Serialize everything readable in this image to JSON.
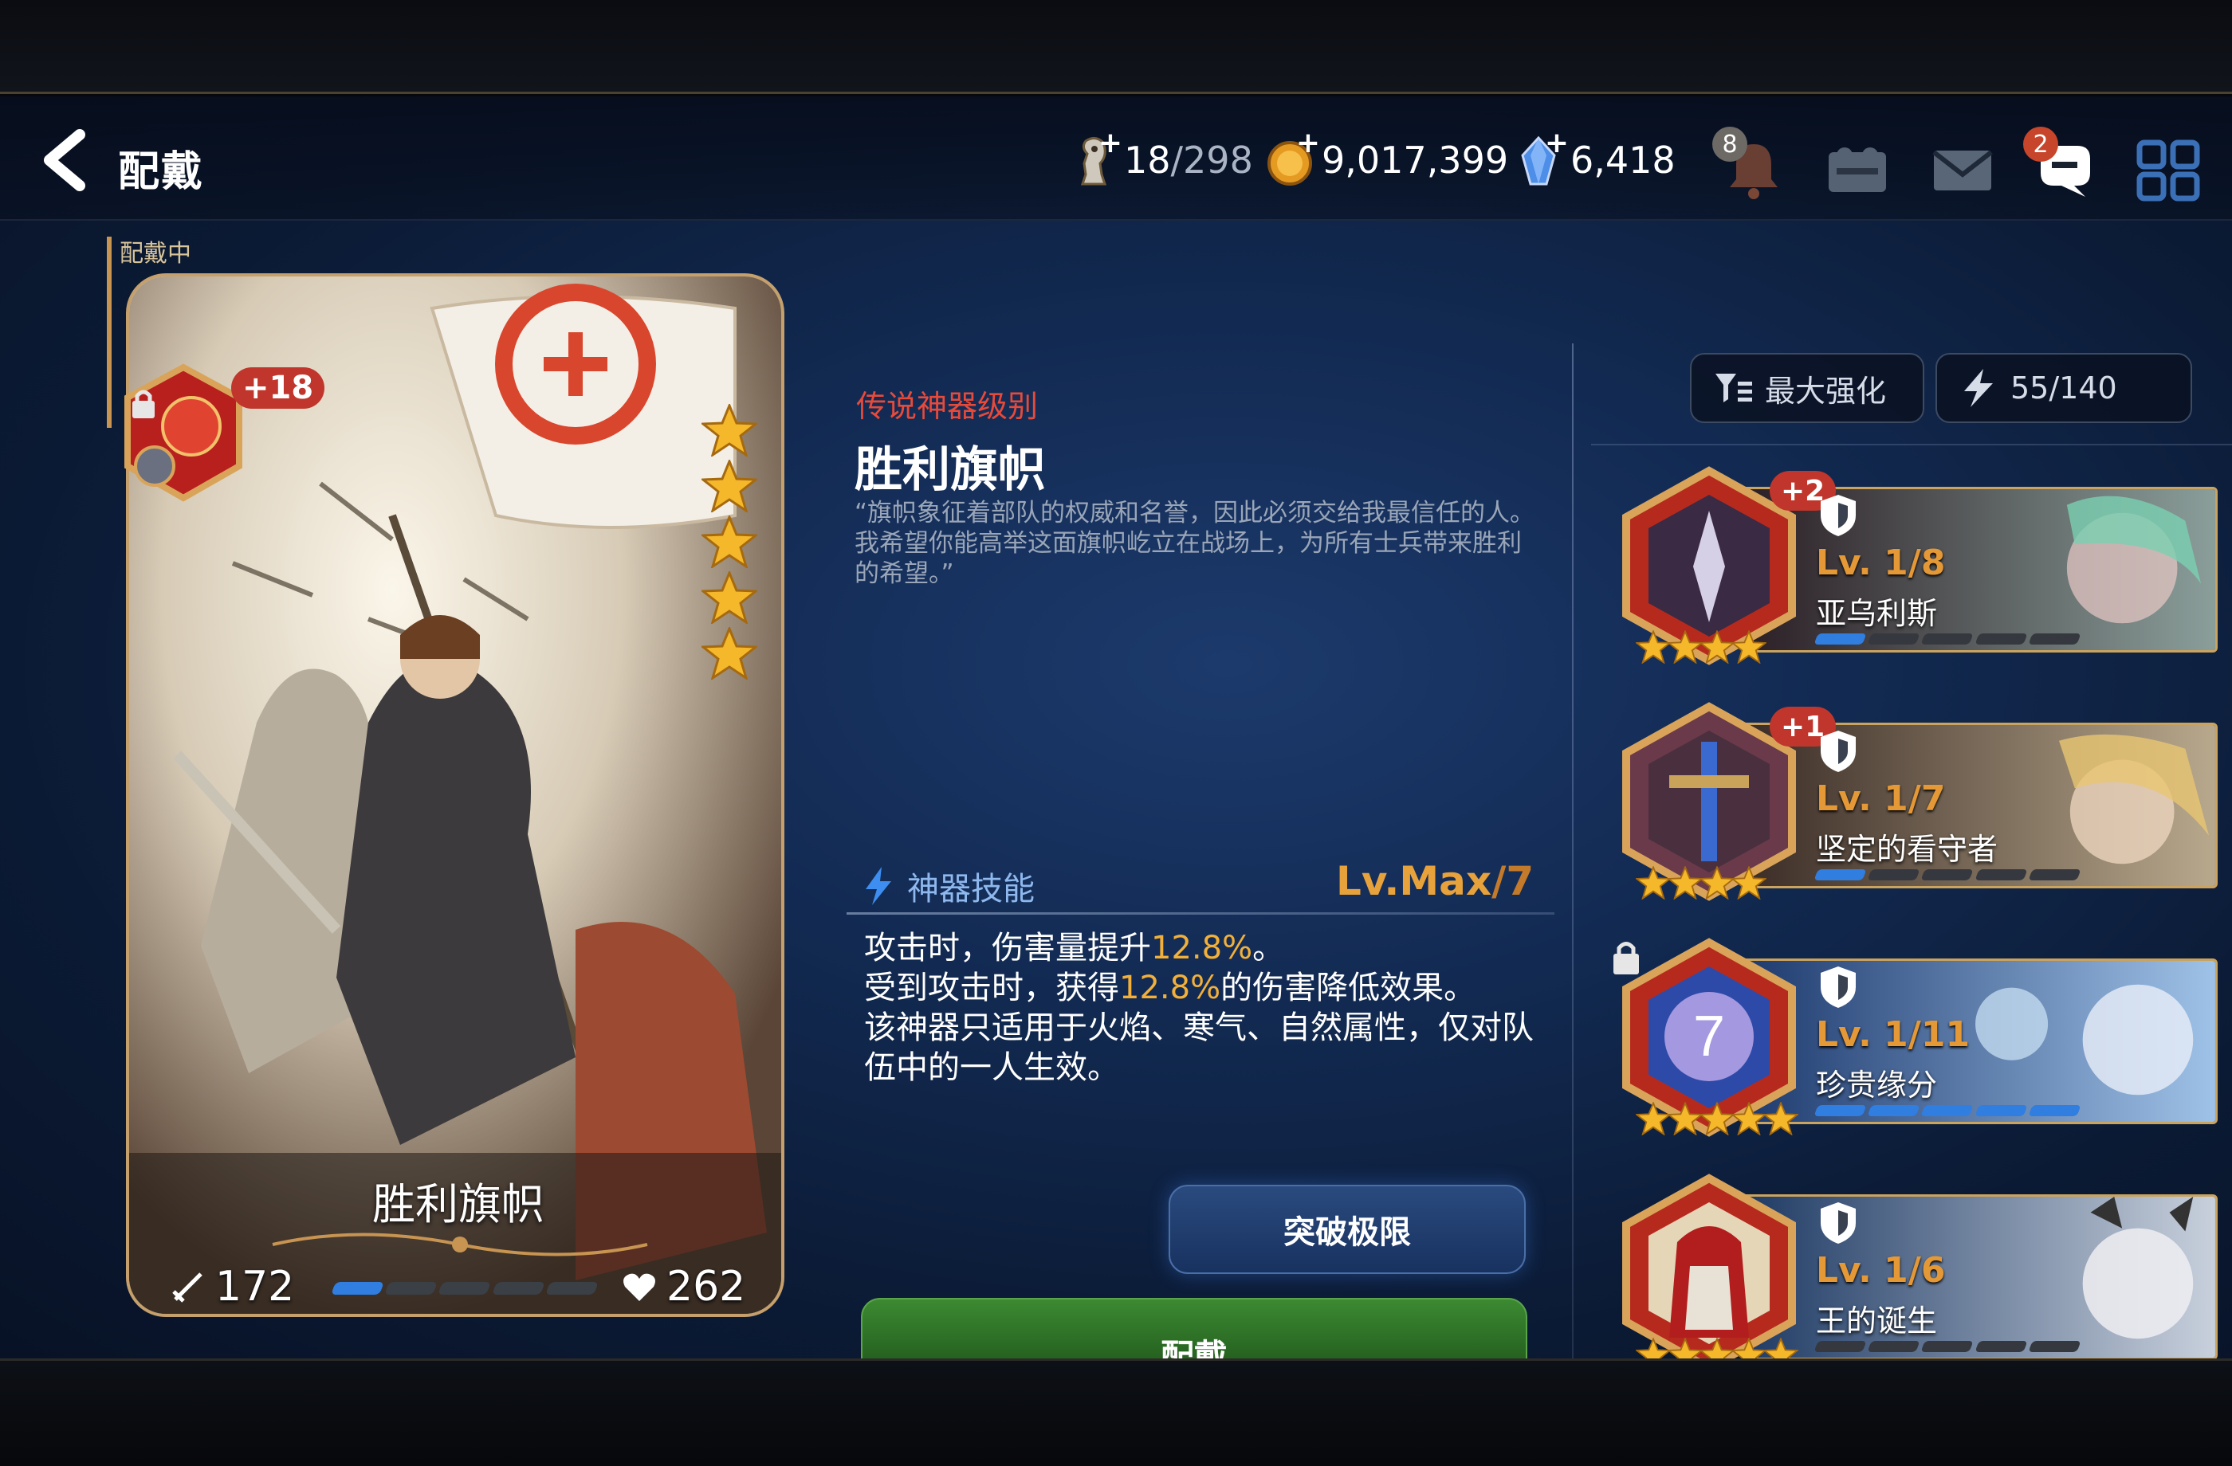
{
  "header": {
    "title": "配戴",
    "resources": {
      "stamina_current": "18",
      "stamina_max": "/298",
      "gold": "9,017,399",
      "crystal": "6,418"
    },
    "notification_badge": "8",
    "chat_badge": "2"
  },
  "card": {
    "equipped_label": "配戴中",
    "enhance_level": "+18",
    "name": "胜利旗帜",
    "attack": "172",
    "health": "262",
    "stars": 5,
    "exp_segments_filled": 1,
    "exp_segments_total": 5
  },
  "detail": {
    "rarity": "传说神器级别",
    "name": "胜利旗帜",
    "description": "“旗帜象征着部队的权威和名誉，因此必须交给我最信任的人。我希望你能高举这面旗帜屹立在战场上，为所有士兵带来胜利的希望。”",
    "skill_label": "神器技能",
    "skill_level": "Lv.Max",
    "skill_level_max": "/7",
    "skill_line1_a": "攻击时，伤害量提升",
    "skill_line1_b": "12.8%",
    "skill_line1_c": "。",
    "skill_line2_a": "受到攻击时，获得",
    "skill_line2_b": "12.8%",
    "skill_line2_c": "的伤害降低效果。",
    "skill_line3": "该神器只适用于火焰、寒气、自然属性，仅对队伍中的一人生效。",
    "break_button": "突破极限",
    "equip_button": "配戴"
  },
  "list": {
    "sort_label": "最大强化",
    "capacity": "55/140",
    "items": [
      {
        "enhance": "+2",
        "level": "Lv. 1/8",
        "name": "亚乌利斯",
        "stars": 4,
        "bar_filled": 1,
        "locked": false
      },
      {
        "enhance": "+1",
        "level": "Lv. 1/7",
        "name": "坚定的看守者",
        "stars": 4,
        "bar_filled": 1,
        "locked": false
      },
      {
        "enhance": "",
        "level": "Lv. 1/11",
        "name": "珍贵缘分",
        "stars": 5,
        "bar_filled": 5,
        "locked": true
      },
      {
        "enhance": "",
        "level": "Lv. 1/6",
        "name": "王的诞生",
        "stars": 5,
        "bar_filled": 0,
        "locked": false
      }
    ]
  },
  "colors": {
    "accent_gold": "#e59836",
    "rarity_red": "#e84a3a",
    "equip_green": "#3c8a32",
    "highlight": "#f2b03a"
  }
}
